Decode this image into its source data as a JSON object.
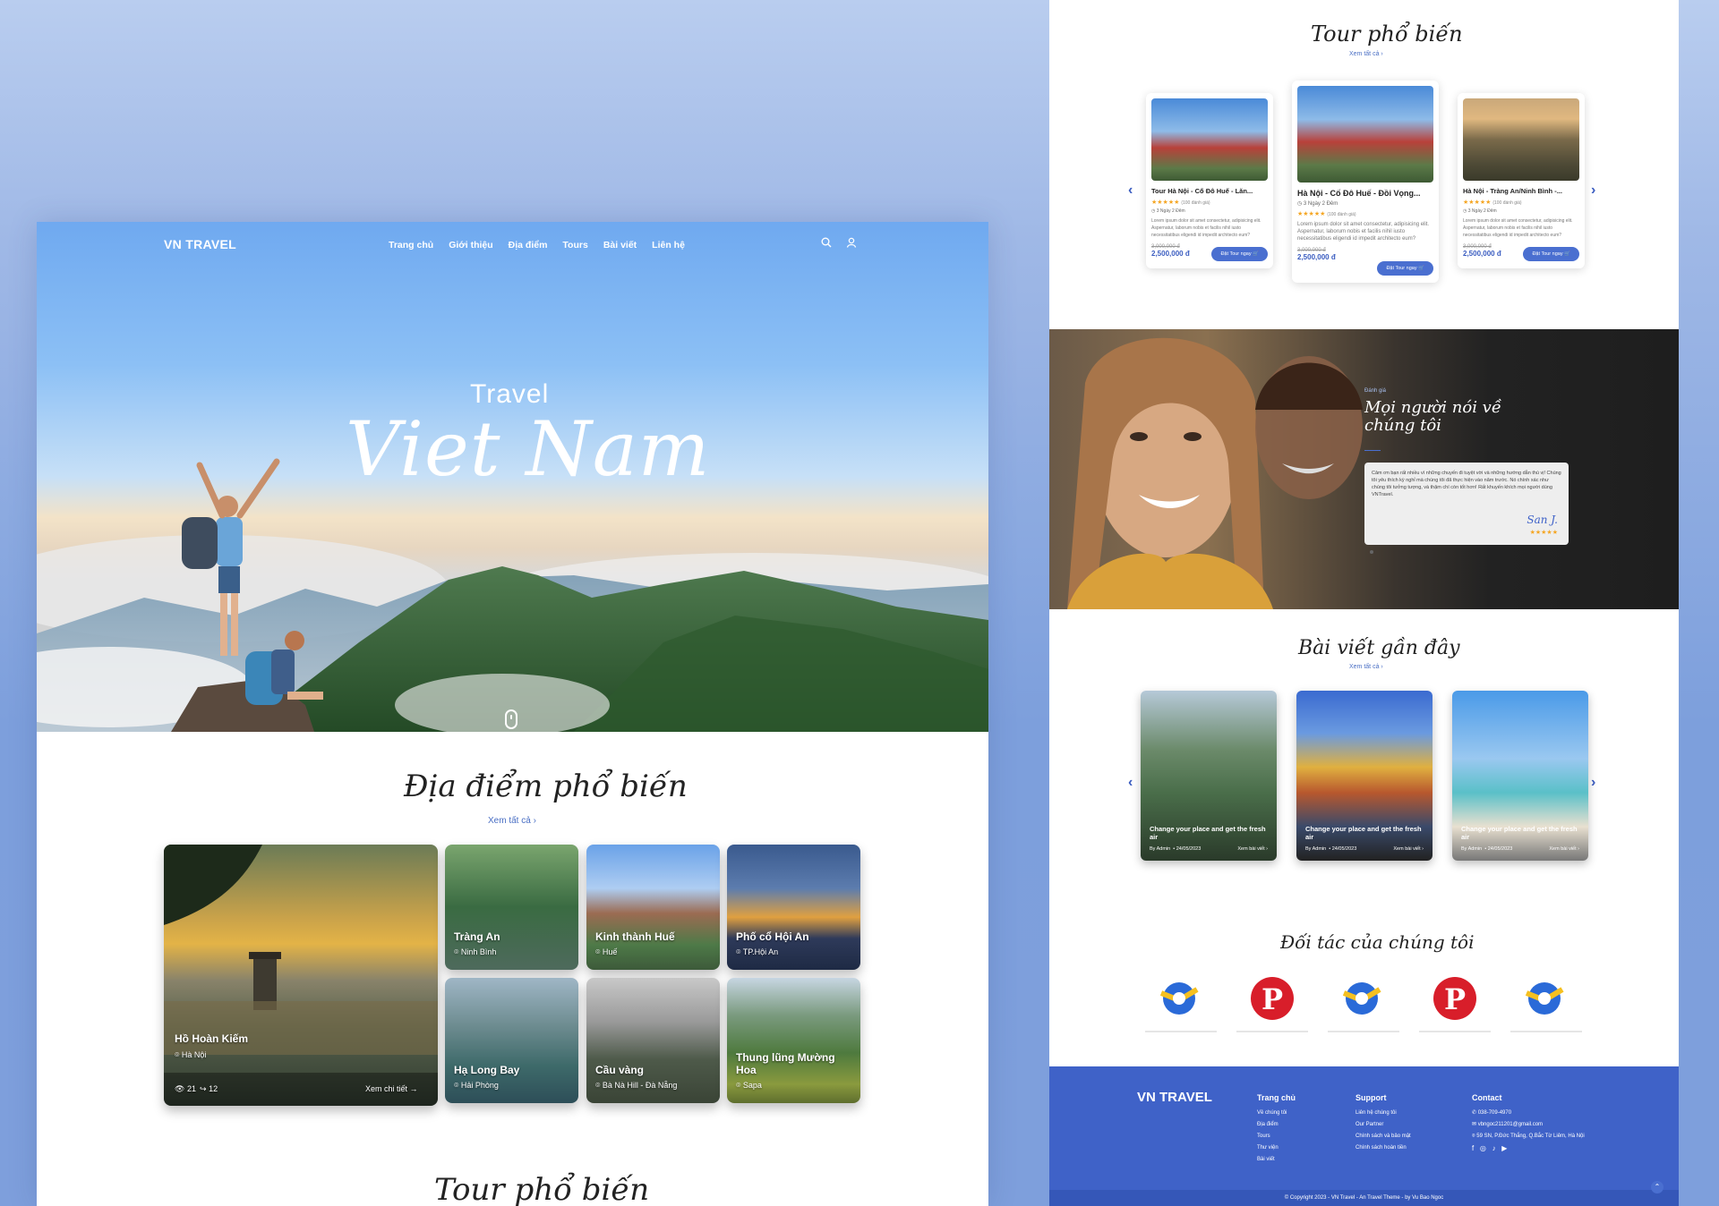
{
  "colors": {
    "accent": "#3f62c8",
    "text": "#222222",
    "star": "#f5a623"
  },
  "left": {
    "nav": {
      "brand": "VN TRAVEL",
      "items": [
        "Trang chủ",
        "Giới thiệu",
        "Địa điểm",
        "Tours",
        "Bài viết",
        "Liên hệ"
      ],
      "icons": [
        "search-icon",
        "user-icon"
      ]
    },
    "hero": {
      "small": "Travel",
      "big": "Viet Nam"
    },
    "places": {
      "title": "Địa điểm phổ biến",
      "see_all": "Xem tất cả",
      "main": {
        "name": "Hồ Hoàn Kiếm",
        "location": "Hà Nội",
        "views": "21",
        "shares": "12",
        "detail": "Xem chi tiết"
      },
      "items": [
        {
          "name": "Tràng An",
          "location": "Ninh Bình"
        },
        {
          "name": "Kinh thành Huế",
          "location": "Huế"
        },
        {
          "name": "Phố cổ Hội An",
          "location": "TP.Hội An"
        },
        {
          "name": "Hạ Long Bay",
          "location": "Hải Phòng"
        },
        {
          "name": "Cầu vàng",
          "location": "Bà Nà Hill - Đà Nẵng"
        },
        {
          "name": "Thung lũng Mường Hoa",
          "location": "Sapa"
        }
      ]
    },
    "tours_title": "Tour phổ biến"
  },
  "right": {
    "tours": {
      "title": "Tour phổ biến",
      "see_all": "Xem tất cả",
      "items": [
        {
          "title": "Tour Hà Nội - Cố Đô Huế - Lăn...",
          "reviews": "(100 đánh giá)",
          "duration": "3 Ngày 2 Đêm",
          "desc": "Lorem ipsum dolor sit amet consectetur, adipisicing elit. Aspernatur, laborum nobis et facilis nihil iusto necessitatibus eligendi id impedit architecto eum?",
          "old": "3,000,000 đ",
          "price": "2,500,000 đ",
          "button": "Đặt Tour ngay"
        },
        {
          "title": "Hà Nội - Cố Đô Huế - Đồi Vọng...",
          "reviews": "(100 đánh giá)",
          "duration": "3 Ngày 2 Đêm",
          "desc": "Lorem ipsum dolor sit amet consectetur, adipisicing elit. Aspernatur, laborum nobis et facilis nihil iusto necessitatibus eligendi id impedit architecto eum?",
          "old": "3,000,000 đ",
          "price": "2,500,000 đ",
          "button": "Đặt Tour ngay"
        },
        {
          "title": "Hà Nội - Tràng An/Ninh Bình -...",
          "reviews": "(100 đánh giá)",
          "duration": "3 Ngày 2 Đêm",
          "desc": "Lorem ipsum dolor sit amet consectetur, adipisicing elit. Aspernatur, laborum nobis et facilis nihil iusto necessitatibus eligendi id impedit architecto eum?",
          "old": "3,000,000 đ",
          "price": "2,500,000 đ",
          "button": "Đặt Tour ngay"
        }
      ]
    },
    "review": {
      "label": "Đánh giá",
      "title1": "Mọi người nói về",
      "title2": "chúng tôi",
      "text": "Cảm ơn bạn rất nhiều vì những chuyến đi tuyệt vời và những hướng dẫn thú vị! Chúng tôi yêu thích kỳ nghỉ mà chúng tôi đã thực hiện vào năm trước. Nó chính xác như chúng tôi tưởng tượng, và thậm chí còn tốt hơn! Rất khuyến khích mọi người dùng VNTravel.",
      "author": "San J.",
      "stars": 5
    },
    "blog": {
      "title": "Bài viết gần đây",
      "see_all": "Xem tất cả",
      "items": [
        {
          "caption": "Change your place and get the fresh air",
          "by": "By Admin",
          "date": "24/05/2023",
          "more": "Xem bài viết"
        },
        {
          "caption": "Change your place and get the fresh air",
          "by": "By Admin",
          "date": "24/05/2023",
          "more": "Xem bài viết"
        },
        {
          "caption": "Change your place and get the fresh air",
          "by": "By Admin",
          "date": "24/05/2023",
          "more": "Xem bài viết"
        }
      ]
    },
    "partners_title": "Đối tác của chúng tôi",
    "footer": {
      "brand": "VN TRAVEL",
      "col1": {
        "title": "Trang chủ",
        "items": [
          "Về chúng tôi",
          "Địa điểm",
          "Tours",
          "Thư viện",
          "Bài viết"
        ]
      },
      "col2": {
        "title": "Support",
        "items": [
          "Liên hệ chúng tôi",
          "Our Partner",
          "Chính sách và bảo mật",
          "Chính sách hoàn tiền"
        ]
      },
      "col3": {
        "title": "Contact",
        "phone": "038-709-4970",
        "email": "vbngoc211201@gmail.com",
        "address": "59 SN, P.Đức Thắng, Q.Bắc Từ Liêm, Hà Nội"
      },
      "copyright": "© Copyright 2023 - VN Travel - An Travel Theme - by Vu Bao Ngoc"
    }
  }
}
